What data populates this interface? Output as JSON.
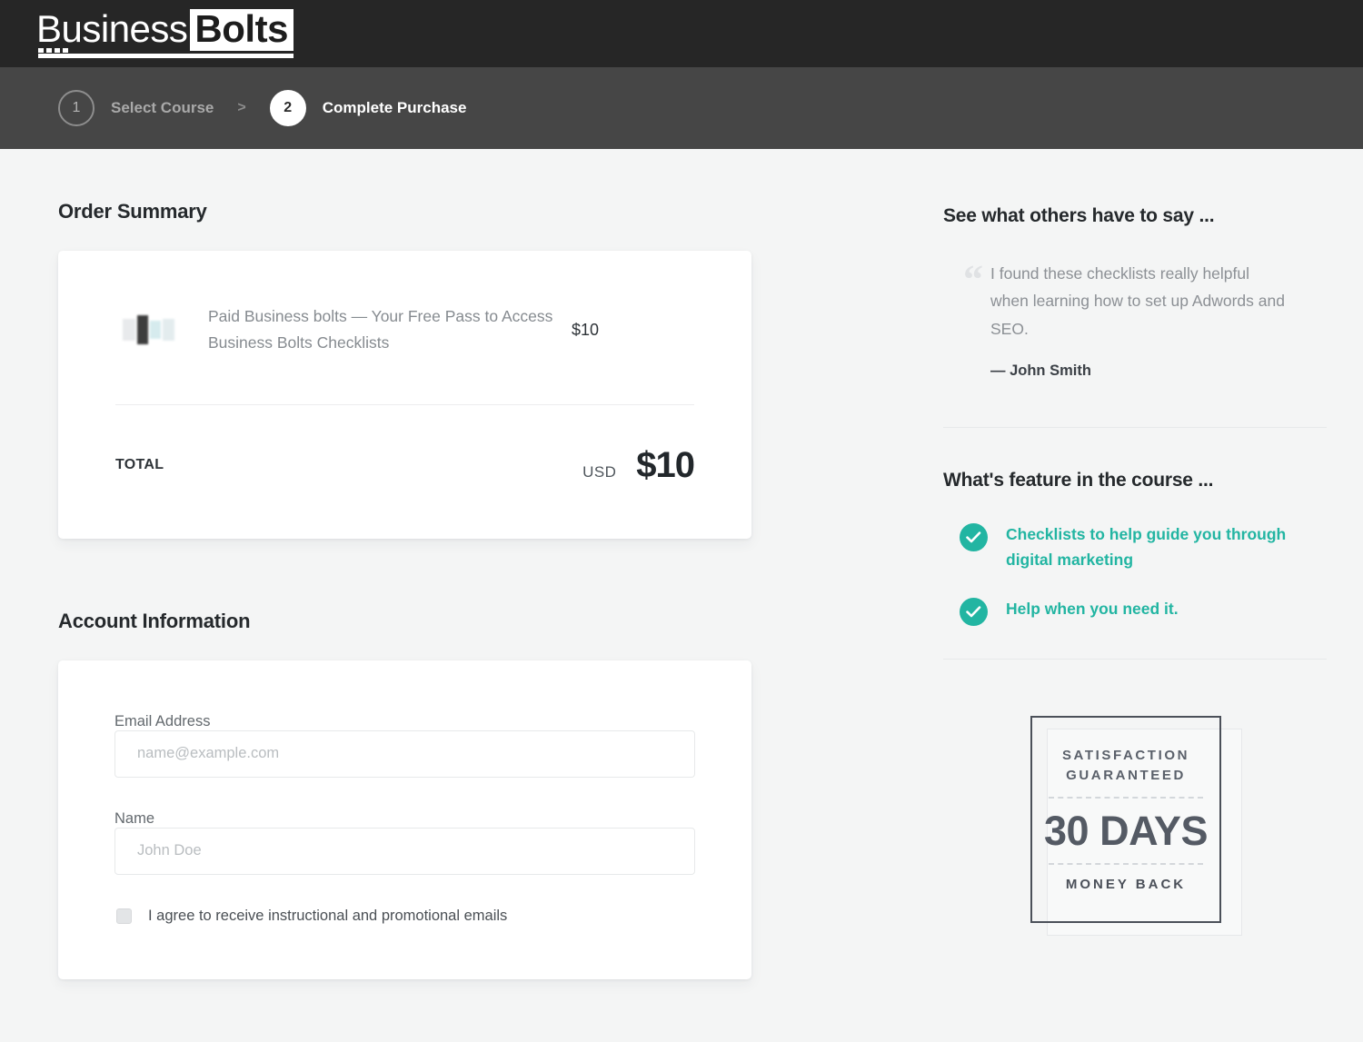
{
  "brand": {
    "word1": "Business",
    "word2": "Bolts"
  },
  "steps": {
    "separator": ">",
    "items": [
      {
        "number": "1",
        "label": "Select Course",
        "active": false
      },
      {
        "number": "2",
        "label": "Complete Purchase",
        "active": true
      }
    ]
  },
  "order": {
    "heading": "Order Summary",
    "item": {
      "title": "Paid Business bolts — Your Free Pass to Access Business Bolts Checklists",
      "price": "$10"
    },
    "total_label": "TOTAL",
    "total_currency": "USD",
    "total_amount": "$10"
  },
  "account": {
    "heading": "Account Information",
    "email_label": "Email Address",
    "email_value": "",
    "email_placeholder": "name@example.com",
    "name_label": "Name",
    "name_value": "",
    "name_placeholder": "John Doe",
    "consent_label": "I agree to receive instructional and promotional emails",
    "consent_checked": false
  },
  "testimonial": {
    "heading": "See what others have to say ...",
    "quote_glyph": "“",
    "quote": "I found these checklists really helpful when learning how to set up Adwords and SEO.",
    "author": "— John Smith"
  },
  "features": {
    "heading": "What's feature in the course ...",
    "items": [
      {
        "text": "Checklists to help guide you through digital marketing"
      },
      {
        "text": "Help when you need it."
      }
    ]
  },
  "guarantee_badge": {
    "line1": "SATISFACTION",
    "line2": "GUARANTEED",
    "days": "30 DAYS",
    "money_back": "MONEY BACK"
  },
  "colors": {
    "brand_bar": "#262626",
    "step_bar": "#464646",
    "page_bg": "#f4f5f5",
    "accent_teal": "#22b5a2",
    "card_bg": "#ffffff",
    "heading_text": "#25292c",
    "muted_text": "#8c9095"
  }
}
